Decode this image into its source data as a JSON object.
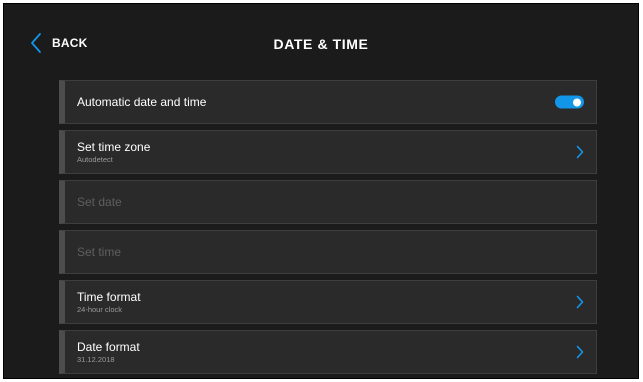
{
  "header": {
    "back_label": "BACK",
    "title": "DATE & TIME"
  },
  "colors": {
    "accent": "#1296e8",
    "background": "#1b1b1b",
    "row_background": "#2a2a2a"
  },
  "settings": {
    "automatic": {
      "label": "Automatic date and time",
      "enabled": true
    },
    "time_zone": {
      "label": "Set time zone",
      "value": "Autodetect",
      "icon": "chevron-right-icon"
    },
    "set_date": {
      "label": "Set date",
      "disabled": true
    },
    "set_time": {
      "label": "Set time",
      "disabled": true
    },
    "time_format": {
      "label": "Time format",
      "value": "24-hour clock",
      "icon": "chevron-right-icon"
    },
    "date_format": {
      "label": "Date format",
      "value": "31.12.2018",
      "icon": "chevron-right-icon"
    }
  }
}
